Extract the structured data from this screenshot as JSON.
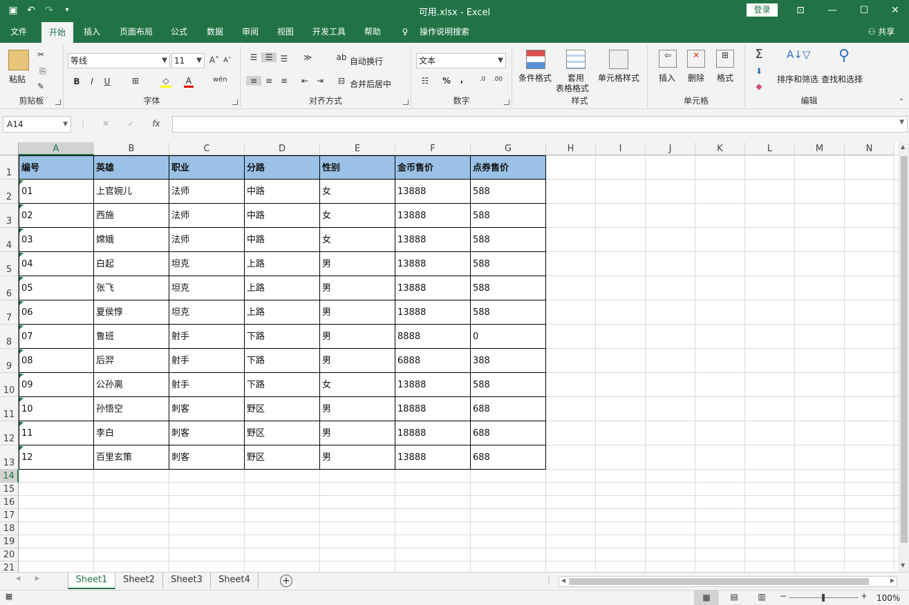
{
  "window": {
    "title": "可用.xlsx  -  Excel",
    "login": "登录",
    "share": "共享"
  },
  "tabs": [
    "文件",
    "开始",
    "插入",
    "页面布局",
    "公式",
    "数据",
    "审阅",
    "视图",
    "开发工具",
    "帮助",
    "操作说明搜索"
  ],
  "ribbon": {
    "clipboard": {
      "paste": "粘贴",
      "label": "剪贴板"
    },
    "font": {
      "name": "等线",
      "size": "11",
      "bold": "B",
      "italic": "I",
      "underline": "U",
      "label": "字体"
    },
    "align": {
      "wrap": "自动换行",
      "merge": "合并后居中",
      "label": "对齐方式"
    },
    "number": {
      "format": "文本",
      "percent": "%",
      "comma": ",",
      "label": "数字"
    },
    "styles": {
      "cond": "条件格式",
      "table1": "套用",
      "table2": "表格格式",
      "cellstyle": "单元格样式",
      "label": "样式"
    },
    "cells": {
      "insert": "插入",
      "delete": "删除",
      "format": "格式",
      "label": "单元格"
    },
    "edit": {
      "sort": "排序和筛选",
      "find": "查找和选择",
      "label": "编辑"
    }
  },
  "namebox": "A14",
  "fx": "fx",
  "columns": [
    "A",
    "B",
    "C",
    "D",
    "E",
    "F",
    "G",
    "H",
    "I",
    "J",
    "K",
    "L",
    "M",
    "N"
  ],
  "rows": [
    "1",
    "2",
    "3",
    "4",
    "5",
    "6",
    "7",
    "8",
    "9",
    "10",
    "11",
    "12",
    "13",
    "14",
    "15",
    "16",
    "17",
    "18",
    "19",
    "20",
    "21"
  ],
  "table": {
    "header": [
      "编号",
      "英雄",
      "职业",
      "分路",
      "性别",
      "金币售价",
      "点券售价"
    ],
    "data": [
      [
        "01",
        "上官婉儿",
        "法师",
        "中路",
        "女",
        "13888",
        "588"
      ],
      [
        "02",
        "西施",
        "法师",
        "中路",
        "女",
        "13888",
        "588"
      ],
      [
        "03",
        "嫦娥",
        "法师",
        "中路",
        "女",
        "13888",
        "588"
      ],
      [
        "04",
        "白起",
        "坦克",
        "上路",
        "男",
        "13888",
        "588"
      ],
      [
        "05",
        "张飞",
        "坦克",
        "上路",
        "男",
        "13888",
        "588"
      ],
      [
        "06",
        "夏侯惇",
        "坦克",
        "上路",
        "男",
        "13888",
        "588"
      ],
      [
        "07",
        "鲁班",
        "射手",
        "下路",
        "男",
        "8888",
        "0"
      ],
      [
        "08",
        "后羿",
        "射手",
        "下路",
        "男",
        "6888",
        "388"
      ],
      [
        "09",
        "公孙离",
        "射手",
        "下路",
        "女",
        "13888",
        "588"
      ],
      [
        "10",
        "孙悟空",
        "刺客",
        "野区",
        "男",
        "18888",
        "688"
      ],
      [
        "11",
        "李白",
        "刺客",
        "野区",
        "男",
        "18888",
        "688"
      ],
      [
        "12",
        "百里玄策",
        "刺客",
        "野区",
        "男",
        "13888",
        "688"
      ]
    ]
  },
  "sheets": [
    "Sheet1",
    "Sheet2",
    "Sheet3",
    "Sheet4"
  ],
  "status": {
    "zoom": "100%"
  }
}
